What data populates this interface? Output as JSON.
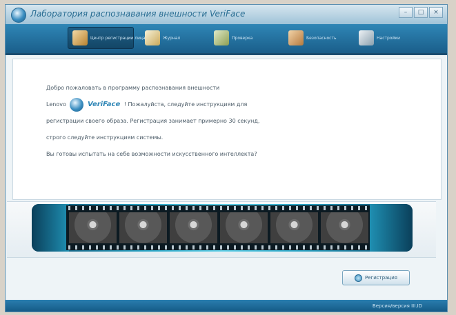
{
  "window": {
    "title": "Лаборатория распознавания внешности VeriFace",
    "controls": [
      "–",
      "□",
      "×"
    ]
  },
  "toolbar": {
    "tabs": [
      {
        "label": "Центр регистрации лица",
        "icon": "face-registration-icon",
        "active": true
      },
      {
        "label": "Журнал",
        "icon": "log-icon",
        "active": false
      },
      {
        "label": "Проверка",
        "icon": "verify-icon",
        "active": false
      },
      {
        "label": "Безопасность",
        "icon": "security-icon",
        "active": false
      },
      {
        "label": "Настройки",
        "icon": "settings-icon",
        "active": false
      }
    ]
  },
  "intro": {
    "line1": "Добро пожаловать в программу распознавания внешности",
    "line2_prefix": "Lenovo",
    "brand": "VeriFace",
    "line2_suffix": "! Пожалуйста, следуйте инструкциям для",
    "line3": "регистрации своего образа. Регистрация занимает примерно 30 секунд,",
    "line4": "строго следуйте инструкциям системы.",
    "line5": "Вы готовы испытать на себе возможности искусственного интеллекта?"
  },
  "actions": {
    "register_label": "Регистрация"
  },
  "status": {
    "version": "Версия/версия III.ID"
  },
  "colors": {
    "accent": "#2f86b6",
    "toolbar": "#1a5e8a",
    "statusbar": "#155a86"
  }
}
